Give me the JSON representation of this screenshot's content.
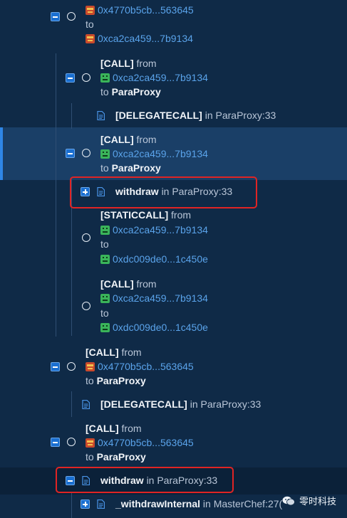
{
  "rows": {
    "r1": {
      "addr_from": "0x4770b5cb...563645",
      "word": "to",
      "addr_to": "0xca2ca459...7b9134"
    },
    "r2": {
      "type": "[CALL]",
      "from_word": "from",
      "addr_from": "0xca2ca459...7b9134",
      "to_word": "to",
      "target": "ParaProxy"
    },
    "r3": {
      "type": "[DELEGATECALL]",
      "in_text": "in ParaProxy:33"
    },
    "r4": {
      "type": "[CALL]",
      "from_word": "from",
      "addr_from": "0xca2ca459...7b9134",
      "to_word": "to",
      "target": "ParaProxy"
    },
    "r5": {
      "func": "withdraw",
      "in_text": "in ParaProxy:33"
    },
    "r6": {
      "type": "[STATICCALL]",
      "from_word": "from",
      "addr_from": "0xca2ca459...7b9134",
      "to_word": "to",
      "addr_to": "0xdc009de0...1c450e"
    },
    "r7": {
      "type": "[CALL]",
      "from_word": "from",
      "addr_from": "0xca2ca459...7b9134",
      "to_word": "to",
      "addr_to": "0xdc009de0...1c450e"
    },
    "r8": {
      "type": "[CALL]",
      "from_word": "from",
      "addr_from": "0x4770b5cb...563645",
      "to_word": "to",
      "target": "ParaProxy"
    },
    "r9": {
      "type": "[DELEGATECALL]",
      "in_text": "in ParaProxy:33"
    },
    "r10": {
      "type": "[CALL]",
      "from_word": "from",
      "addr_from": "0x4770b5cb...563645",
      "to_word": "to",
      "target": "ParaProxy"
    },
    "r11": {
      "func": "withdraw",
      "in_text": "in ParaProxy:33"
    },
    "r12": {
      "func": "_withdrawInternal",
      "in_text": "in MasterChef:27("
    }
  },
  "watermark": {
    "text": "零时科技"
  },
  "colors": {
    "background": "#0f2a47",
    "selected_row": "#1a3f67",
    "accent": "#1a6fd1",
    "address": "#5aa3ea",
    "highlight_box": "#e02424"
  },
  "icons": {
    "expand": "minus-square-icon",
    "collapse": "plus-square-icon",
    "node": "circle-icon",
    "file": "document-icon",
    "avatar_red": "identicon-red",
    "avatar_green": "identicon-green"
  }
}
